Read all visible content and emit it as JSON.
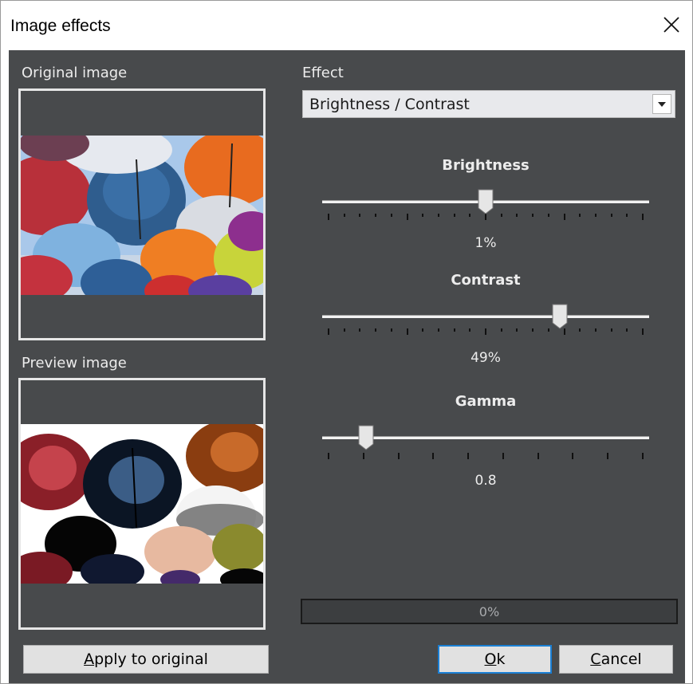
{
  "window": {
    "title": "Image effects",
    "close_icon": "close-icon"
  },
  "labels": {
    "original_image": "Original image",
    "preview_image": "Preview image",
    "effect": "Effect"
  },
  "effect_select": {
    "value": "Brightness / Contrast"
  },
  "sliders": {
    "brightness": {
      "label": "Brightness",
      "value_text": "1%",
      "value": 1,
      "fraction": 0.5
    },
    "contrast": {
      "label": "Contrast",
      "value_text": "49%",
      "value": 49,
      "fraction": 0.735
    },
    "gamma": {
      "label": "Gamma",
      "value_text": "0.8",
      "value": 0.8,
      "fraction": 0.12
    }
  },
  "progress": {
    "text": "0%",
    "value": 0
  },
  "buttons": {
    "apply": {
      "prefix": "",
      "accel": "A",
      "rest": "pply to original"
    },
    "ok": {
      "prefix": "",
      "accel": "O",
      "rest": "k"
    },
    "cancel": {
      "prefix": "",
      "accel": "C",
      "rest": "ancel"
    }
  },
  "colors": {
    "panel_bg": "#484a4c",
    "frame": "#e6e6e6",
    "text_light": "#ececec",
    "default_button_border": "#1a7fd4"
  }
}
